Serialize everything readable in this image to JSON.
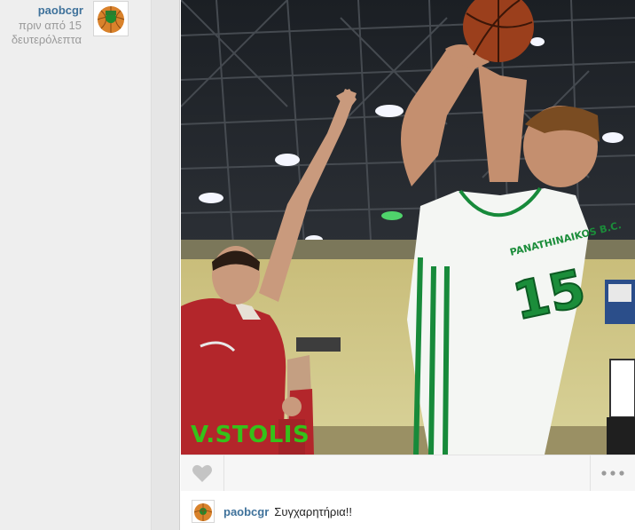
{
  "sidebar_post": {
    "username": "paobcgr",
    "time_line1": "πριν από 15",
    "time_line2": "δευτερόλεπτα"
  },
  "photo": {
    "overlay_text": "V.STOLIS",
    "jersey_text": "PANATHINAIKOS B.C.",
    "jersey_number": "15"
  },
  "actions": {
    "like_icon": "heart-icon",
    "more_icon": "ellipsis-icon"
  },
  "comment": {
    "username": "paobcgr",
    "text": "Συγχαρητήρια!!"
  },
  "colors": {
    "username": "#3f729b",
    "overlay_text": "#35c219"
  }
}
